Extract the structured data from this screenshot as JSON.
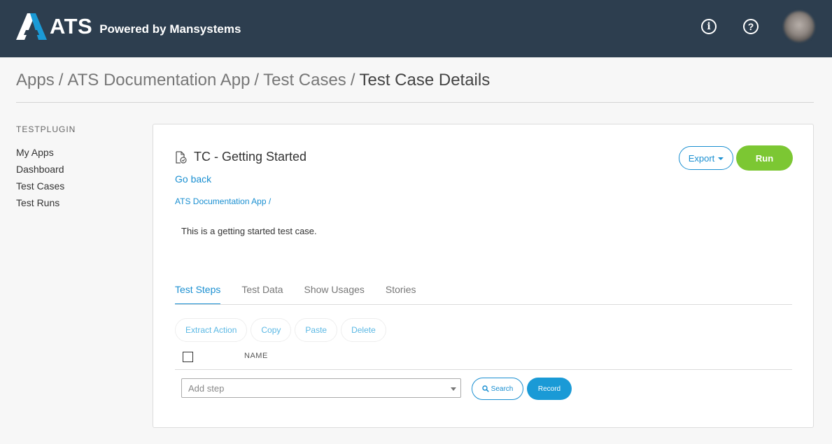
{
  "header": {
    "logo_text": "ATS",
    "powered_by": "Powered by Mansystems",
    "icons": [
      "info-icon",
      "help-icon",
      "avatar"
    ],
    "colors": {
      "bar": "#2d3e4f",
      "logo_accent": "#1a9ad6"
    }
  },
  "breadcrumb": {
    "items": [
      "Apps",
      "ATS Documentation App",
      "Test Cases"
    ],
    "separator": "/",
    "current": "Test Case Details"
  },
  "sidebar": {
    "heading": "TESTPLUGIN",
    "items": [
      {
        "label": "My Apps"
      },
      {
        "label": "Dashboard"
      },
      {
        "label": "Test Cases"
      },
      {
        "label": "Test Runs"
      }
    ]
  },
  "test_case": {
    "icon": "test-case-document-icon",
    "title": "TC - Getting Started",
    "go_back": "Go back",
    "app_link": "ATS Documentation App /",
    "description": "This is a getting started test case.",
    "export_label": "Export",
    "run_label": "Run"
  },
  "tabs": [
    {
      "label": "Test Steps",
      "active": true
    },
    {
      "label": "Test Data",
      "active": false
    },
    {
      "label": "Show Usages",
      "active": false
    },
    {
      "label": "Stories",
      "active": false
    }
  ],
  "actions": {
    "extract": "Extract Action",
    "copy": "Copy",
    "paste": "Paste",
    "delete": "Delete"
  },
  "table": {
    "columns": [
      "NAME"
    ]
  },
  "add_step": {
    "placeholder": "Add step",
    "search_label": "Search",
    "record_label": "Record"
  },
  "colors": {
    "primary": "#1a8fd1",
    "run_green": "#7cc733",
    "record_blue": "#1a9ad6"
  }
}
